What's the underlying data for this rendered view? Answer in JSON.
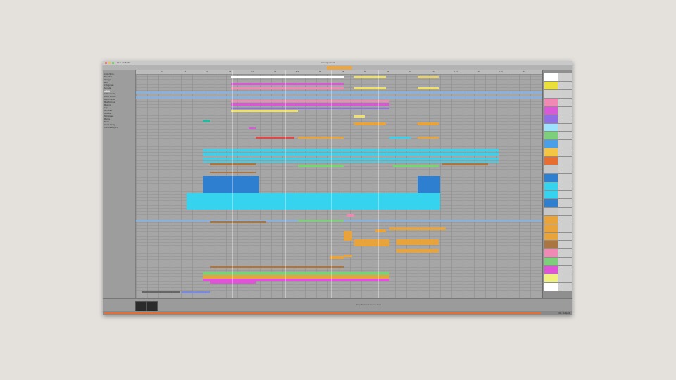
{
  "window": {
    "title": "Live 11 Suite",
    "project": "Arrangement",
    "status": "No Output"
  },
  "browser": {
    "items": [
      "Collections",
      "Favorites",
      "Orange",
      "Red",
      "Categories",
      "Sounds",
      "Drums",
      "Instruments",
      "Audio Effects",
      "MIDI Effects",
      "Max for Live",
      "Plug-ins",
      "Clips",
      "Samples",
      "Grooves",
      "Templates",
      "Places",
      "Packs",
      "User Library",
      "Current Project"
    ],
    "selected_index": 6
  },
  "ruler": {
    "markers": [
      "1",
      "9",
      "17",
      "25",
      "33",
      "41",
      "49",
      "57",
      "65",
      "73",
      "81",
      "89",
      "97",
      "105",
      "113",
      "121",
      "129",
      "137",
      "145"
    ]
  },
  "colors": {
    "accent": "#e86d30",
    "cyan": "#35d3ee",
    "blue": "#2f7fd0",
    "magenta": "#e052d8",
    "yellow": "#efe06a",
    "orange": "#e8a33a",
    "brown": "#a97643",
    "green": "#7ecf7b",
    "pink": "#f08ab5"
  },
  "mixer": {
    "track_colors": [
      "#ffffff",
      "#e9e03c",
      "#cfcfcf",
      "#f08ab5",
      "#d95ad6",
      "#8f6ee6",
      "#9de3ff",
      "#7ecf7b",
      "#4aa0e8",
      "#f4c542",
      "#e86d30",
      "#c7c7c7",
      "#2f7fd0",
      "#35d3ee",
      "#35d3ee",
      "#2f7fd0",
      "#c7c7c7",
      "#e8a33a",
      "#e8a33a",
      "#e8a33a",
      "#a97643",
      "#f08ab5",
      "#7ecf7b",
      "#e052d8",
      "#f0f080",
      "#ffffff"
    ]
  },
  "bottom": {
    "hint": "Drop Files and Devices Here"
  }
}
